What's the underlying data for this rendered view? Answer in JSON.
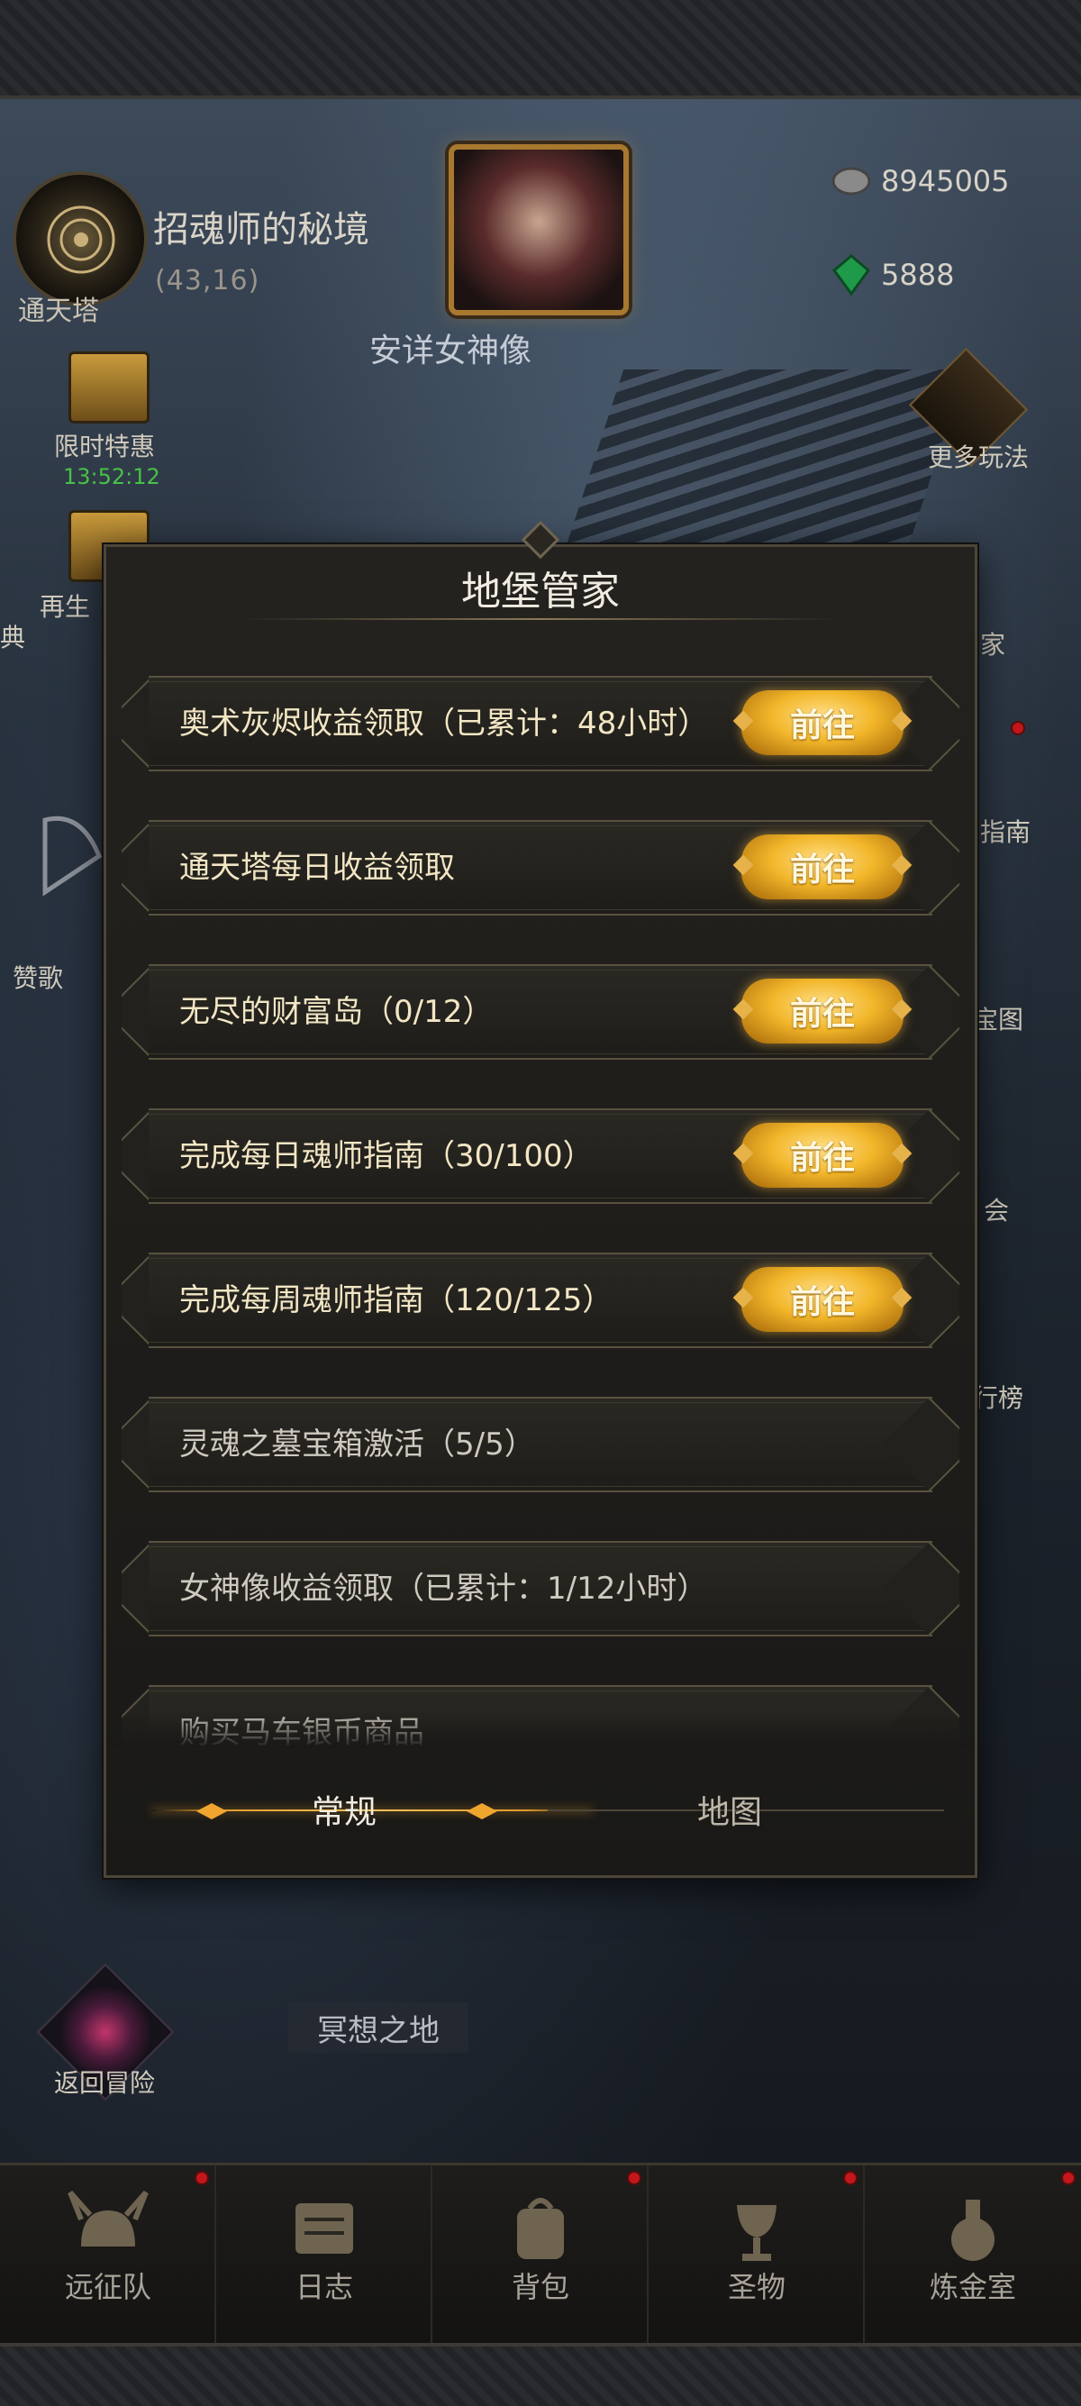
{
  "location": {
    "name": "招魂师的秘境",
    "coords": "(43,16)",
    "tower_label": "通天塔"
  },
  "portrait": {
    "label": "安详女神像"
  },
  "currencies": [
    {
      "icon": "silver-coin-icon",
      "value": "8945005"
    },
    {
      "icon": "green-gem-icon",
      "value": "5888"
    }
  ],
  "left_side": {
    "limited_offer": {
      "label": "限时特惠",
      "timer": "13:52:12"
    },
    "rebirth": {
      "label": "再生",
      "edge": "典"
    },
    "hymn": {
      "label": "赞歌"
    }
  },
  "right_side": {
    "more_play": "更多玩法",
    "partial_labels": [
      "家",
      "指南",
      "宝图",
      "会",
      "行榜"
    ]
  },
  "dialog": {
    "title": "地堡管家",
    "tasks": [
      {
        "text": "奥术灰烬收益领取（已累计：48小时）",
        "button": "前往"
      },
      {
        "text": "通天塔每日收益领取",
        "button": "前往"
      },
      {
        "text": "无尽的财富岛（0/12）",
        "button": "前往"
      },
      {
        "text": "完成每日魂师指南（30/100）",
        "button": "前往"
      },
      {
        "text": "完成每周魂师指南（120/125）",
        "button": "前往"
      },
      {
        "text": "灵魂之墓宝箱激活（5/5）",
        "button": ""
      },
      {
        "text": "女神像收益领取（已累计：1/12小时）",
        "button": ""
      },
      {
        "text": "购买马车银币商品",
        "button": ""
      }
    ],
    "tabs": {
      "active": "常规",
      "inactive": "地图"
    }
  },
  "return_adventure": "返回冒险",
  "meditation_place": "冥想之地",
  "bottom_nav": [
    {
      "label": "远征队",
      "icon": "horned-helmet-icon"
    },
    {
      "label": "日志",
      "icon": "scroll-icon"
    },
    {
      "label": "背包",
      "icon": "backpack-icon"
    },
    {
      "label": "圣物",
      "icon": "chalice-icon"
    },
    {
      "label": "炼金室",
      "icon": "alchemy-icon"
    }
  ],
  "colors": {
    "gold": "#f2b62a",
    "timer_green": "#46c246",
    "badge_red": "#c3171b",
    "panel": "#1f1d19"
  }
}
